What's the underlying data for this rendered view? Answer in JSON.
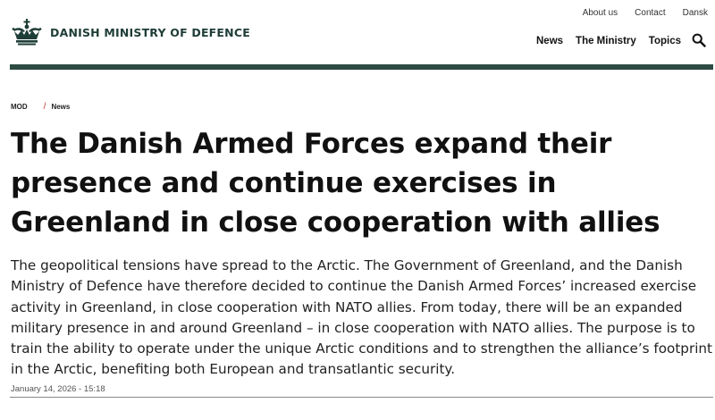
{
  "utility_nav": {
    "about": "About us",
    "contact": "Contact",
    "language": "Dansk"
  },
  "header": {
    "logo_text": "DANISH MINISTRY OF DEFENCE",
    "logo_icon": "crown-icon",
    "nav": [
      "News",
      "The Ministry",
      "Topics"
    ],
    "search_icon": "search-icon",
    "accent_color": "#2d4b42"
  },
  "breadcrumb": {
    "root": "MOD",
    "separator": "/",
    "current": "News",
    "separator_color": "#c0392b"
  },
  "article": {
    "title": "The Danish Armed Forces expand their presence and continue exercises in Greenland in close cooperation with allies",
    "lead": "The geopolitical tensions have spread to the Arctic. The Government of Greenland, and the Danish Ministry of Defence have therefore decided to continue the Danish Armed Forces’ increased exercise activity in Greenland, in close cooperation with NATO allies. From today, there will be an expanded military presence in and around Greenland – in close cooperation with NATO allies. The purpose is to train the ability to operate under the unique Arctic conditions and to strengthen the alliance’s footprint in the Arctic, benefiting both European and transatlantic security.",
    "timestamp": "January 14, 2026 - 15:18"
  }
}
